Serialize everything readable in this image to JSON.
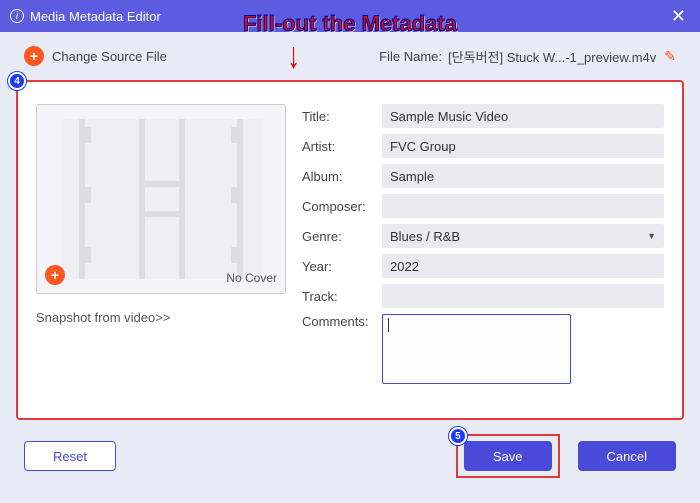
{
  "window": {
    "title": "Media Metadata Editor"
  },
  "overlay": {
    "headline": "Fill-out the Metadata",
    "badge4": "4",
    "badge5": "5"
  },
  "toolbar": {
    "change_source": "Change Source File",
    "filename_label": "File Name:",
    "filename_value": "[단독버전] Stuck W...-1_preview.m4v"
  },
  "cover": {
    "no_cover": "No Cover",
    "snapshot_link": "Snapshot from video>>"
  },
  "form": {
    "title_label": "Title:",
    "title_value": "Sample Music Video",
    "artist_label": "Artist:",
    "artist_value": "FVC Group",
    "album_label": "Album:",
    "album_value": "Sample",
    "composer_label": "Composer:",
    "composer_value": "",
    "genre_label": "Genre:",
    "genre_value": "Blues / R&B",
    "year_label": "Year:",
    "year_value": "2022",
    "track_label": "Track:",
    "track_value": "",
    "comments_label": "Comments:",
    "comments_value": ""
  },
  "buttons": {
    "reset": "Reset",
    "save": "Save",
    "cancel": "Cancel"
  }
}
